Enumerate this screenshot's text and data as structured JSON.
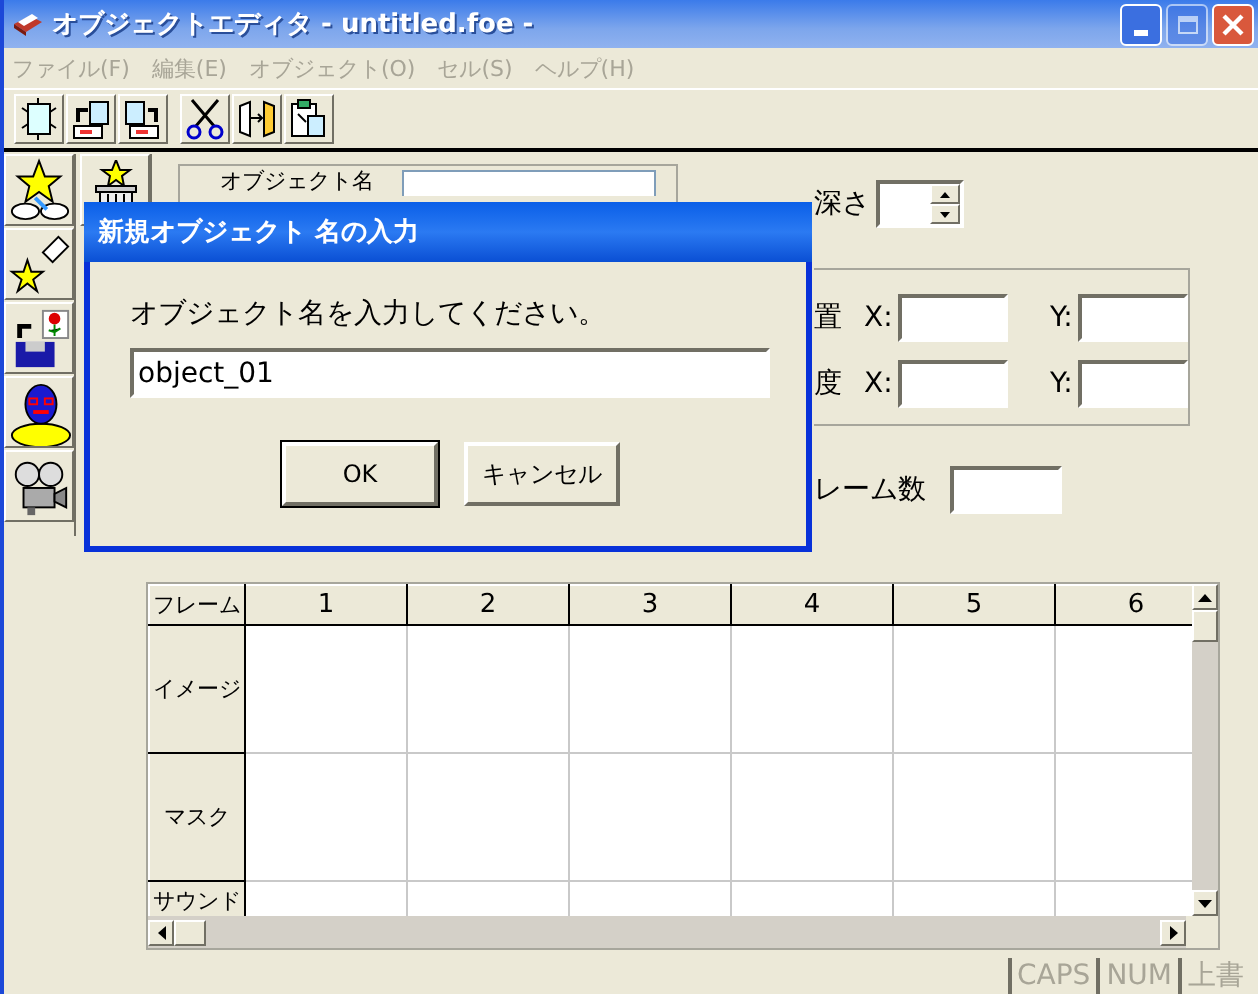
{
  "window": {
    "title": "オブジェクトエディタ - untitled.foe -"
  },
  "menu": [
    {
      "label": "ファイル(F)",
      "disabled": true
    },
    {
      "label": "編集(E)",
      "disabled": true
    },
    {
      "label": "オブジェクト(O)",
      "disabled": true
    },
    {
      "label": "セル(S)",
      "disabled": true
    },
    {
      "label": "ヘルプ(H)",
      "disabled": true
    }
  ],
  "toolbar": [
    {
      "buttons": [
        {
          "kind": "new"
        },
        {
          "kind": "import"
        },
        {
          "kind": "export"
        }
      ]
    },
    {
      "buttons": [
        {
          "kind": "cut"
        },
        {
          "kind": "flip"
        },
        {
          "kind": "paste"
        }
      ]
    }
  ],
  "palette": [
    {
      "kind": "star-egg"
    },
    {
      "kind": "star-eraser"
    },
    {
      "kind": "save-flower"
    },
    {
      "kind": "character"
    },
    {
      "kind": "projector"
    }
  ],
  "object_name": {
    "label": "オブジェクト名"
  },
  "depth": {
    "label": "深さ"
  },
  "position": {
    "label": "置",
    "x_label": "X:",
    "y_label": "Y:"
  },
  "speed": {
    "label": "度",
    "x_label": "X:",
    "y_label": "Y:"
  },
  "frame_count": {
    "label": "レーム数"
  },
  "grid": {
    "corner": "フレーム",
    "columns": [
      "1",
      "2",
      "3",
      "4",
      "5",
      "6"
    ],
    "rows": [
      "イメージ",
      "マスク",
      "サウンド"
    ]
  },
  "status_bar": [
    {
      "label": "CAPS",
      "on": false
    },
    {
      "label": "NUM",
      "on": false
    },
    {
      "label": "上書",
      "on": false
    }
  ],
  "dialog": {
    "title": "新規オブジェクト 名の入力",
    "prompt": "オブジェクト名を入力してください。",
    "value": "object_01",
    "buttons": [
      {
        "label": "OK",
        "kind": "default"
      },
      {
        "label": "キャンセル",
        "kind": "normal"
      }
    ]
  }
}
